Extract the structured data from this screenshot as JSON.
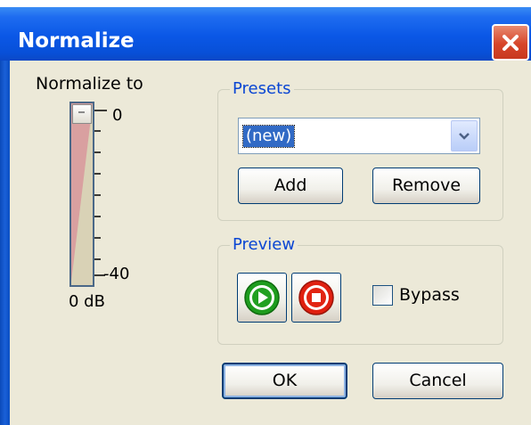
{
  "window": {
    "title": "Normalize"
  },
  "slider": {
    "label": "Normalize to",
    "top_label": "0",
    "bottom_label": "-40",
    "unit_label": "0 dB",
    "value_db": 0
  },
  "presets": {
    "caption": "Presets",
    "selected": "(new)",
    "add_label": "Add",
    "remove_label": "Remove"
  },
  "preview": {
    "caption": "Preview",
    "bypass_label": "Bypass",
    "bypass_checked": false
  },
  "buttons": {
    "ok": "OK",
    "cancel": "Cancel"
  },
  "icons": {
    "close": "close-icon",
    "play": "play-icon",
    "stop": "stop-icon",
    "dropdown": "chevron-down-icon"
  },
  "colors": {
    "titlebar": "#0a57e6",
    "close": "#d6452a",
    "group_caption": "#0a46d3",
    "selection": "#316ac5",
    "slider_fill": "#d9a0a0",
    "play": "#1e9c1e",
    "stop": "#e02010"
  }
}
